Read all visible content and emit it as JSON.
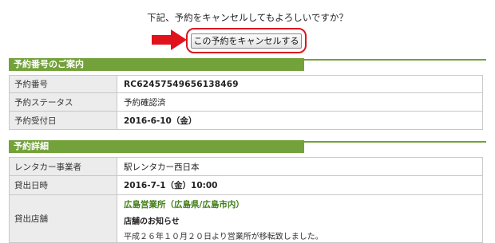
{
  "prompt": {
    "question": "下記、予約をキャンセルしてもよろしいですか？",
    "cancel_button": "この予約をキャンセルする"
  },
  "colors": {
    "section_header": "#73a13a",
    "highlight_red": "#d9181f",
    "label_bg": "#ececec",
    "link_green": "#3f7d16"
  },
  "reservation_info": {
    "heading": "予約番号のご案内",
    "rows": [
      {
        "label": "予約番号",
        "value": "RC62457549656138469"
      },
      {
        "label": "予約ステータス",
        "value": "予約確認済"
      },
      {
        "label": "予約受付日",
        "value": "2016-6-10（金）"
      }
    ]
  },
  "reservation_detail": {
    "heading": "予約詳細",
    "rows": [
      {
        "label": "レンタカー事業者",
        "value": "駅レンタカー西日本"
      },
      {
        "label": "貸出日時",
        "value": "2016-7-1（金）10:00"
      },
      {
        "label": "貸出店舗",
        "store_name": "広島営業所（広島県/広島市内）",
        "notice_title": "店舗のお知らせ",
        "notice_text": "平成２６年１０月２０日より営業所が移転致しました。"
      }
    ]
  },
  "icons": {
    "arrow": "red-right-arrow-icon"
  }
}
